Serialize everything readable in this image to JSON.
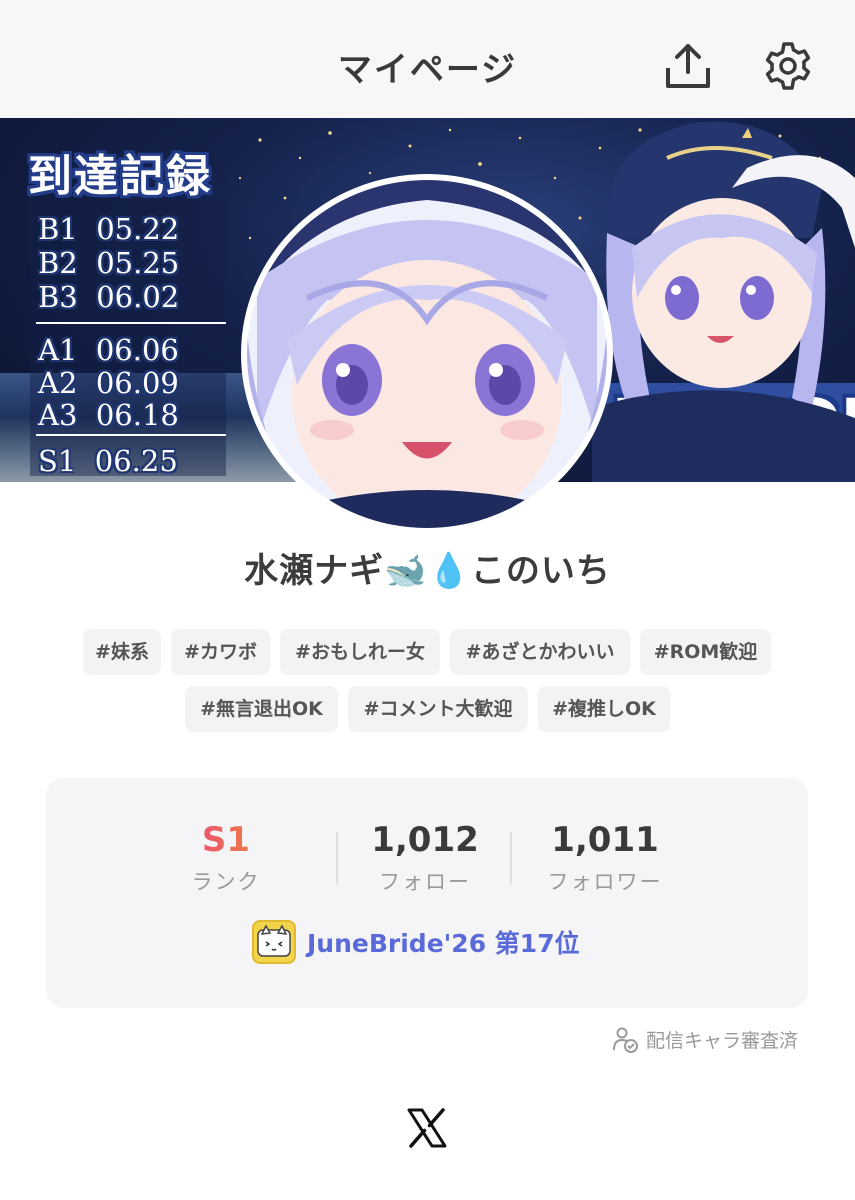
{
  "header": {
    "title": "マイページ",
    "share_icon": "share-upload-icon",
    "settings_icon": "gear-icon"
  },
  "banner": {
    "record_title": "到達記録",
    "records_b": [
      "B1  05.22",
      "B2  05.25",
      "B3  06.02"
    ],
    "records_a": [
      "A1  06.06",
      "A2  06.09",
      "A3  06.18"
    ],
    "records_s": [
      "S1  06.25"
    ],
    "name_graphic_text": "ENAGI"
  },
  "profile": {
    "display_name": "水瀬ナギ🐋💧このいち"
  },
  "tags": {
    "row1": [
      "#妹系",
      "#カワボ",
      "#おもしれー女",
      "#あざとかわいい",
      "#ROM歓迎"
    ],
    "row2": [
      "#無言退出OK",
      "#コメント大歓迎",
      "#複推しOK"
    ]
  },
  "stats": {
    "rank": {
      "value": "S1",
      "label": "ランク"
    },
    "follow": {
      "value": "1,012",
      "label": "フォロー"
    },
    "followers": {
      "value": "1,011",
      "label": "フォロワー"
    },
    "event_text": "JuneBride'26 第17位"
  },
  "verified_text": "配信キャラ審査済",
  "footer": {
    "x_icon": "x-logo-icon"
  },
  "colors": {
    "header_bg": "#f7f7f8",
    "card_bg": "#f5f5f7",
    "event_text": "#5a6ad8",
    "rank_gradient_start": "#e8467a",
    "rank_gradient_end": "#f08a3c"
  }
}
